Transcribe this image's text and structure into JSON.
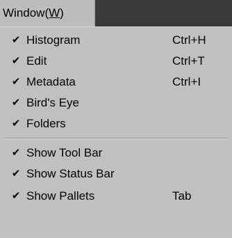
{
  "menubar": {
    "title_prefix": "Window(",
    "title_key": "W",
    "title_suffix": ")"
  },
  "menu": {
    "items": [
      {
        "label": "Histogram",
        "shortcut": "Ctrl+H",
        "check": "✔"
      },
      {
        "label": "Edit",
        "shortcut": "Ctrl+T",
        "check": "✔"
      },
      {
        "label": "Metadata",
        "shortcut": "Ctrl+I",
        "check": "✔"
      },
      {
        "label": "Bird's Eye",
        "shortcut": "",
        "check": "✔"
      },
      {
        "label": "Folders",
        "shortcut": "",
        "check": "✔"
      },
      {
        "label": "Show Tool Bar",
        "shortcut": "",
        "check": "✔"
      },
      {
        "label": "Show Status Bar",
        "shortcut": "",
        "check": "✔"
      },
      {
        "label": "Show Pallets",
        "shortcut": "Tab",
        "check": "✔"
      }
    ]
  }
}
